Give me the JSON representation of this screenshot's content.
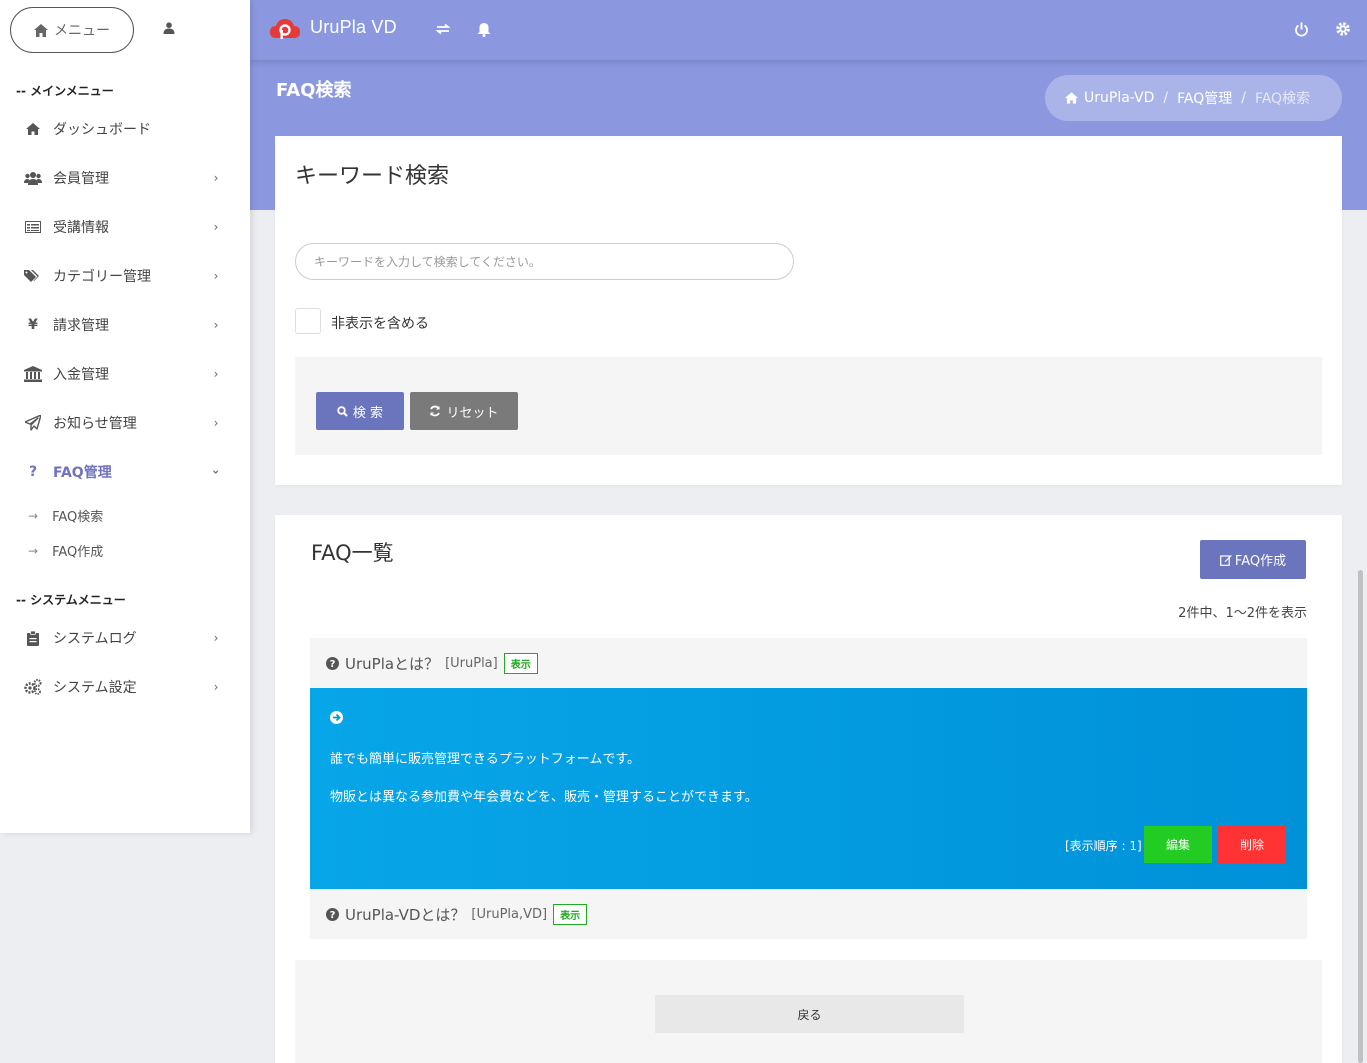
{
  "sidebar": {
    "menu_label": "メニュー",
    "main_section": "-- メインメニュー",
    "system_section": "-- システムメニュー",
    "items": [
      {
        "label": "ダッシュボード",
        "icon": "home-icon"
      },
      {
        "label": "会員管理",
        "icon": "users-icon"
      },
      {
        "label": "受講情報",
        "icon": "list-icon"
      },
      {
        "label": "カテゴリー管理",
        "icon": "tags-icon"
      },
      {
        "label": "請求管理",
        "icon": "yen-icon"
      },
      {
        "label": "入金管理",
        "icon": "bank-icon"
      },
      {
        "label": "お知らせ管理",
        "icon": "paper-plane-icon"
      },
      {
        "label": "FAQ管理",
        "icon": "question-icon"
      }
    ],
    "sub_items": [
      {
        "arrow": "→",
        "label": "FAQ検索"
      },
      {
        "arrow": "→",
        "label": "FAQ作成"
      }
    ],
    "system_items": [
      {
        "label": "システムログ",
        "icon": "clipboard-icon"
      },
      {
        "label": "システム設定",
        "icon": "cogs-icon"
      }
    ]
  },
  "header": {
    "app_title": "UruPla VD",
    "page_title": "FAQ検索",
    "breadcrumb": {
      "home": "UruPla-VD",
      "sep": "/",
      "section": "FAQ管理",
      "current": "FAQ検索"
    }
  },
  "search": {
    "title": "キーワード検索",
    "placeholder": "キーワードを入力して検索してください。",
    "include_hidden_label": "非表示を含める",
    "search_button": "検 索",
    "reset_button": "リセット"
  },
  "faq_list": {
    "title": "FAQ一覧",
    "create_button": "FAQ作成",
    "count_text": "2件中、1〜2件を表示",
    "items": [
      {
        "question": "UruPlaとは？",
        "tag": "[UruPla]",
        "badge": "表示",
        "answer_lines": [
          "誰でも簡単に販売管理できるプラットフォームです。",
          "物販とは異なる参加費や年会費などを、販売・管理することができます。"
        ],
        "order_label": "[表示順序 : 1]",
        "edit_button": "編集",
        "delete_button": "削除"
      },
      {
        "question": "UruPla-VDとは？",
        "tag": "[UruPla,VD]",
        "badge": "表示"
      }
    ],
    "back_button": "戻る"
  },
  "colors": {
    "header_bg": "#8b98e0",
    "primary": "#6a75bd",
    "answer_bg": "#0099dd",
    "edit": "#22cc22",
    "delete": "#ff3333",
    "badge": "#22aa22"
  }
}
